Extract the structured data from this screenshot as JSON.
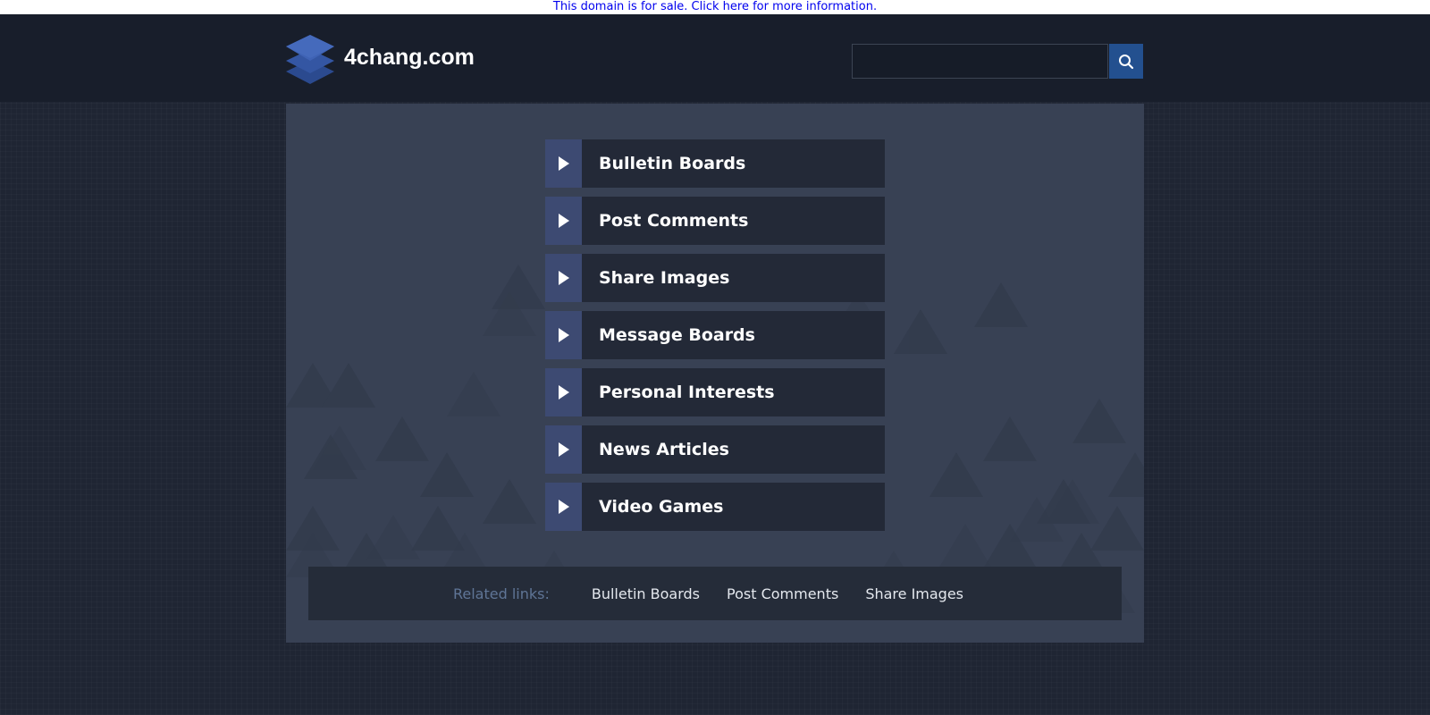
{
  "banner": {
    "text": "This domain is for sale. Click here for more information."
  },
  "header": {
    "site_name": "4chang.com",
    "logo_icon": "stacked-layers-icon",
    "search": {
      "value": "",
      "placeholder": "",
      "button_icon": "search-icon"
    }
  },
  "menu": {
    "items": [
      {
        "label": "Bulletin Boards"
      },
      {
        "label": "Post Comments"
      },
      {
        "label": "Share Images"
      },
      {
        "label": "Message Boards"
      },
      {
        "label": "Personal Interests"
      },
      {
        "label": "News Articles"
      },
      {
        "label": "Video Games"
      }
    ]
  },
  "related": {
    "title": "Related links:",
    "links": [
      {
        "label": "Bulletin Boards"
      },
      {
        "label": "Post Comments"
      },
      {
        "label": "Share Images"
      }
    ]
  },
  "colors": {
    "page_background": "#1f2533",
    "header_background": "#181e2b",
    "panel_background": "#384154",
    "menu_arrow_box": "#3d4a72",
    "menu_label_box": "#232937",
    "search_button": "#23508f",
    "banner_link": "#0000ee",
    "related_title": "#5f7596"
  }
}
